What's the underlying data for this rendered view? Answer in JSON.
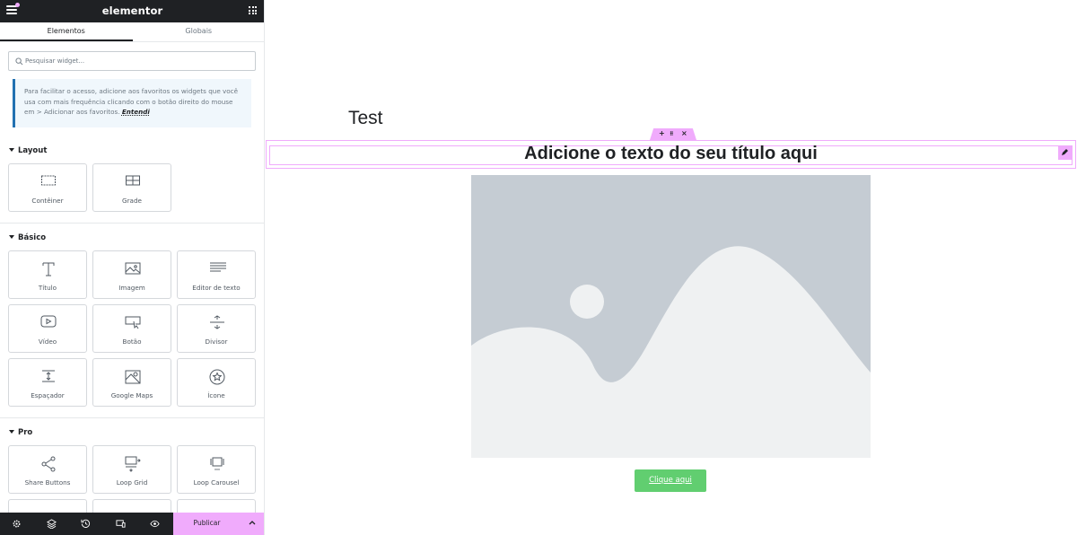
{
  "topbar": {
    "logo": "elementor"
  },
  "tabs": [
    {
      "label": "Elementos"
    },
    {
      "label": "Globais"
    }
  ],
  "search": {
    "placeholder": "Pesquisar widget..."
  },
  "notice": {
    "text": "Para facilitar o acesso, adicione aos favoritos os widgets que você usa com mais frequência clicando com o botão direito do mouse em > Adicionar aos favoritos.",
    "link": "Entendi"
  },
  "sections": {
    "layout": {
      "title": "Layout",
      "items": [
        {
          "label": "Contêiner",
          "icon": "container-icon"
        },
        {
          "label": "Grade",
          "icon": "grid-icon"
        }
      ]
    },
    "basic": {
      "title": "Básico",
      "items": [
        {
          "label": "Título",
          "icon": "heading-icon"
        },
        {
          "label": "Imagem",
          "icon": "image-icon"
        },
        {
          "label": "Editor de texto",
          "icon": "text-editor-icon"
        },
        {
          "label": "Vídeo",
          "icon": "video-icon"
        },
        {
          "label": "Botão",
          "icon": "button-icon"
        },
        {
          "label": "Divisor",
          "icon": "divider-icon"
        },
        {
          "label": "Espaçador",
          "icon": "spacer-icon"
        },
        {
          "label": "Google Maps",
          "icon": "map-icon"
        },
        {
          "label": "Ícone",
          "icon": "star-icon"
        }
      ]
    },
    "pro": {
      "title": "Pro",
      "items": [
        {
          "label": "Share Buttons",
          "icon": "share-icon"
        },
        {
          "label": "Loop Grid",
          "icon": "loop-grid-icon"
        },
        {
          "label": "Loop Carousel",
          "icon": "carousel-icon"
        }
      ]
    }
  },
  "bottombar": {
    "icons": [
      "settings-icon",
      "layers-icon",
      "history-icon",
      "responsive-icon",
      "preview-icon"
    ],
    "publish_label": "Publicar"
  },
  "canvas": {
    "page_title": "Test",
    "heading": "Adicione o texto do seu título aqui",
    "button_label": "Clique aqui"
  },
  "colors": {
    "accent": "#f0abfc",
    "dark": "#1f2124",
    "button": "#61ce70",
    "notice_border": "#2271b1",
    "placeholder_bg": "#c5ccd3",
    "placeholder_fg": "#eff1f2"
  }
}
